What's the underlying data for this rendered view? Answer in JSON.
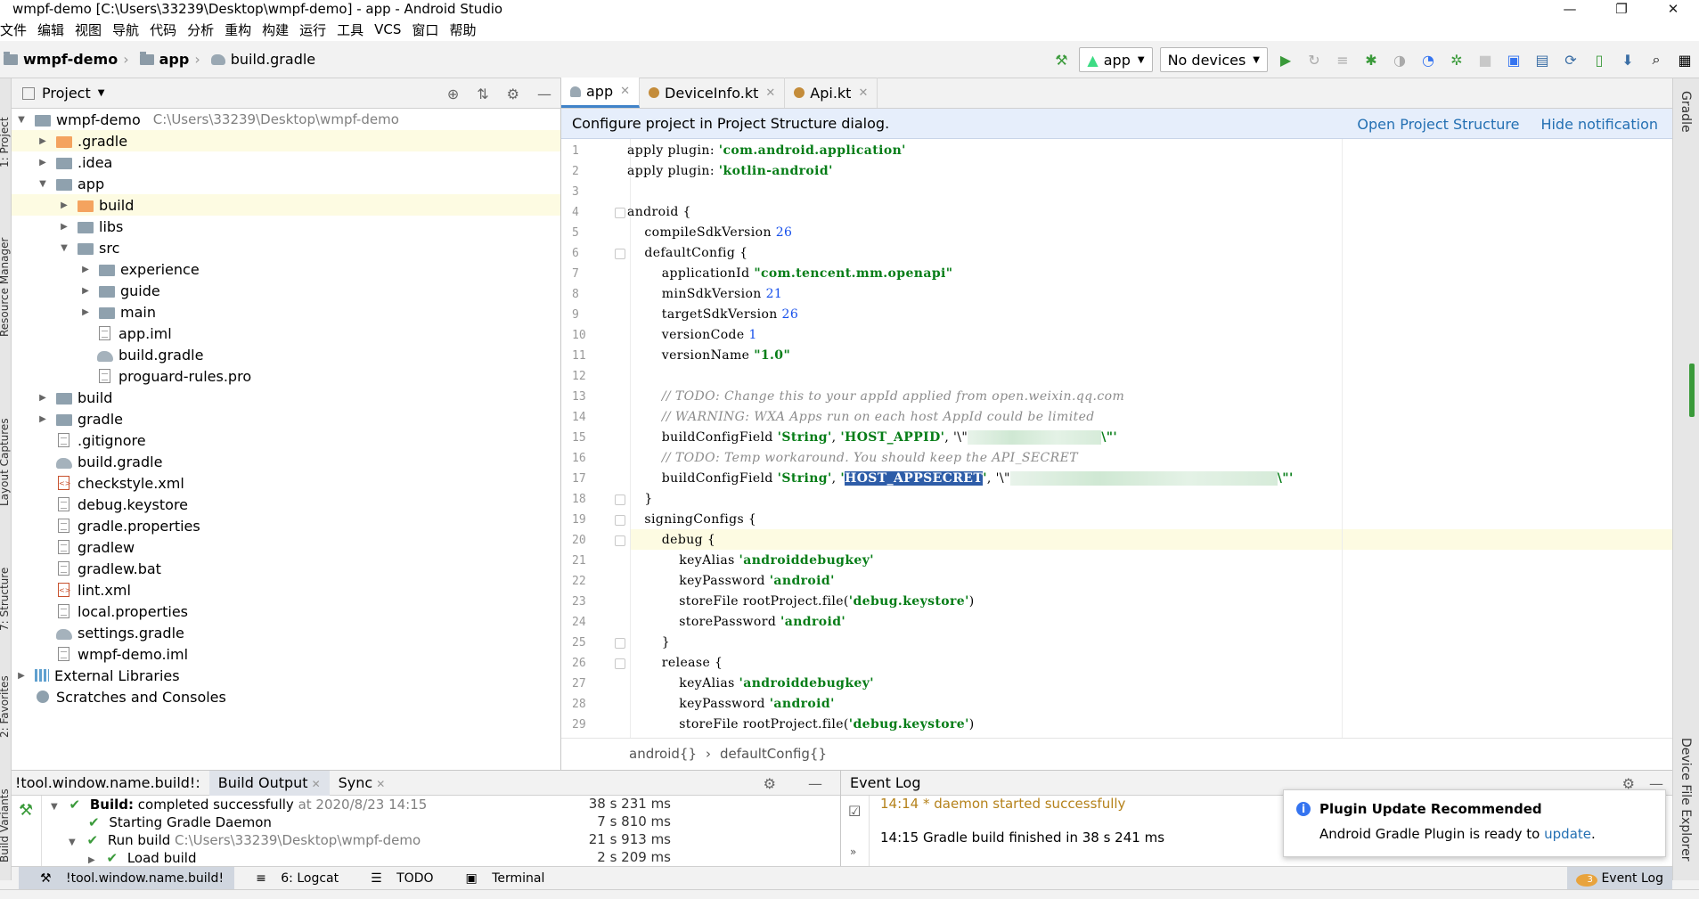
{
  "window": {
    "title": "wmpf-demo [C:\\Users\\33239\\Desktop\\wmpf-demo] - app - Android Studio",
    "minimize": "—",
    "maximize": "❐",
    "close": "✕"
  },
  "menu": [
    "文件",
    "编辑",
    "视图",
    "导航",
    "代码",
    "分析",
    "重构",
    "构建",
    "运行",
    "工具",
    "VCS",
    "窗口",
    "帮助"
  ],
  "breadcrumb": {
    "project": "wmpf-demo",
    "module": "app",
    "file": "build.gradle"
  },
  "toolbar": {
    "run_config": "app",
    "device": "No devices"
  },
  "project_panel": {
    "title": "Project",
    "tree": [
      {
        "label": "wmpf-demo",
        "path": "C:\\Users\\33239\\Desktop\\wmpf-demo",
        "expanded": true
      },
      {
        "label": ".gradle"
      },
      {
        "label": ".idea"
      },
      {
        "label": "app"
      },
      {
        "label": "build"
      },
      {
        "label": "libs"
      },
      {
        "label": "src"
      },
      {
        "label": "experience"
      },
      {
        "label": "guide"
      },
      {
        "label": "main"
      },
      {
        "label": "app.iml"
      },
      {
        "label": "build.gradle"
      },
      {
        "label": "proguard-rules.pro"
      },
      {
        "label": "build"
      },
      {
        "label": "gradle"
      },
      {
        "label": ".gitignore"
      },
      {
        "label": "build.gradle"
      },
      {
        "label": "checkstyle.xml"
      },
      {
        "label": "debug.keystore"
      },
      {
        "label": "gradle.properties"
      },
      {
        "label": "gradlew"
      },
      {
        "label": "gradlew.bat"
      },
      {
        "label": "lint.xml"
      },
      {
        "label": "local.properties"
      },
      {
        "label": "settings.gradle"
      },
      {
        "label": "wmpf-demo.iml"
      },
      {
        "label": "External Libraries"
      },
      {
        "label": "Scratches and Consoles"
      }
    ]
  },
  "editor": {
    "tabs": [
      {
        "label": "app",
        "active": true
      },
      {
        "label": "DeviceInfo.kt"
      },
      {
        "label": "Api.kt"
      }
    ],
    "notification": "Configure project in Project Structure dialog.",
    "notification_links": [
      "Open Project Structure",
      "Hide notification"
    ],
    "lines": [
      "apply plugin: 'com.android.application'",
      "apply plugin: 'kotlin-android'",
      "",
      "android {",
      "    compileSdkVersion 26",
      "    defaultConfig {",
      "        applicationId \"com.tencent.mm.openapi\"",
      "        minSdkVersion 21",
      "        targetSdkVersion 26",
      "        versionCode 1",
      "        versionName \"1.0\"",
      "",
      "        // TODO: Change this to your appId applied from open.weixin.qq.com",
      "        // WARNING: WXA Apps run on each host AppId could be limited",
      "        buildConfigField 'String', 'HOST_APPID', '\\\"",
      "        // TODO: Temp workaround. You should keep the API_SECRET",
      "        buildConfigField 'String', 'HOST_APPSECRET', '\\\"",
      "    }",
      "    signingConfigs {",
      "        debug {",
      "            keyAlias 'androiddebugkey'",
      "            keyPassword 'android'",
      "            storeFile rootProject.file('debug.keystore')",
      "            storePassword 'android'",
      "        }",
      "        release {",
      "            keyAlias 'androiddebugkey'",
      "            keyPassword 'android'",
      "            storeFile rootProject.file('debug.keystore')"
    ],
    "code_breadcrumb": [
      "android{}",
      "defaultConfig{}"
    ]
  },
  "build_window": {
    "tabs": [
      "!tool.window.name.build!:",
      "Build Output",
      "Sync"
    ],
    "rows": [
      {
        "label": "Build:",
        "text": "completed successfully",
        "extra": "at 2020/8/23 14:15",
        "time": "38 s 231 ms"
      },
      {
        "text": "Starting Gradle Daemon",
        "time": "7 s 810 ms"
      },
      {
        "text": "Run build",
        "extra": "C:\\Users\\33239\\Desktop\\wmpf-demo",
        "time": "21 s 913 ms"
      },
      {
        "text": "Load build",
        "time": "2 s 209 ms"
      }
    ]
  },
  "event_log": {
    "title": "Event Log",
    "entries": [
      {
        "time": "14:14",
        "text": "* daemon started successfully"
      },
      {
        "time": "14:15",
        "text": "Gradle build finished in 38 s 241 ms"
      }
    ]
  },
  "balloon": {
    "title": "Plugin Update Recommended",
    "body": "Android Gradle Plugin is ready to",
    "link": "update",
    "tail": "."
  },
  "toolstrip": {
    "items": [
      "!tool.window.name.build!",
      "6: Logcat",
      "TODO",
      "Terminal"
    ],
    "event_log": "Event Log",
    "event_count": "3"
  },
  "stripes": {
    "left": [
      "1: Project",
      "Resource Manager",
      "Layout Captures",
      "7: Structure",
      "2: Favorites",
      "Build Variants"
    ],
    "right": [
      "Gradle",
      "Device File Explorer"
    ]
  },
  "colors": {
    "string": "#067d17",
    "number": "#1750eb",
    "comment": "#8c8c8c",
    "link": "#2470b3",
    "selection": "#2e5da8",
    "caret_line": "#fdfbe2"
  }
}
